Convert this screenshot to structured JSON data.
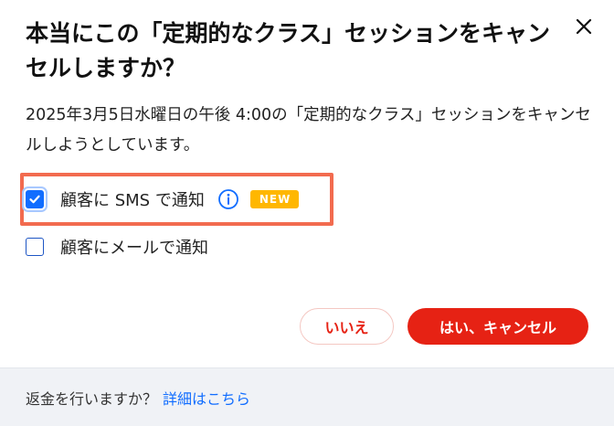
{
  "dialog": {
    "title": "本当にこの「定期的なクラス」セッションをキャンセルしますか？",
    "message": "2025年3月5日水曜日の午後 4:00の「定期的なクラス」セッションをキャンセルしようとしています。",
    "close_icon": "close-icon"
  },
  "options": {
    "sms": {
      "label": "顧客に SMS で通知",
      "checked": true,
      "badge": "NEW",
      "info_icon": "info-icon"
    },
    "email": {
      "label": "顧客にメールで通知",
      "checked": false
    }
  },
  "buttons": {
    "no_label": "いいえ",
    "yes_label": "はい、キャンセル"
  },
  "footer": {
    "question": "返金を行いますか？",
    "link_label": "詳細はこちら"
  },
  "colors": {
    "accent_red": "#e62214",
    "checkbox_blue": "#116dff",
    "badge_yellow": "#ffb700",
    "highlight_orange": "#f26b4f",
    "footer_bg": "#f0f2f6"
  }
}
